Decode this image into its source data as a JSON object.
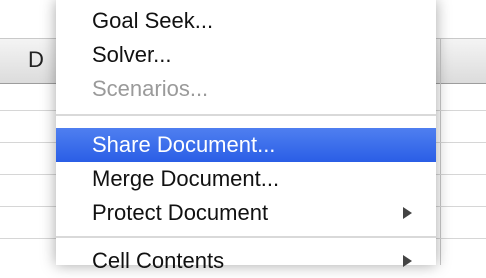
{
  "spreadsheet": {
    "visible_column_letter": "D"
  },
  "menu": {
    "items": [
      {
        "label": "Goal Seek...",
        "enabled": true,
        "highlighted": false
      },
      {
        "label": "Solver...",
        "enabled": true,
        "highlighted": false
      },
      {
        "label": "Scenarios...",
        "enabled": false,
        "highlighted": false
      },
      {
        "label": "Share Document...",
        "enabled": true,
        "highlighted": true
      },
      {
        "label": "Merge Document...",
        "enabled": true,
        "highlighted": false
      },
      {
        "label": "Protect Document",
        "enabled": true,
        "highlighted": false,
        "submenu": true
      },
      {
        "label": "Cell Contents",
        "enabled": true,
        "highlighted": false,
        "submenu": true
      }
    ],
    "highlight_color": "#2f63e8"
  }
}
